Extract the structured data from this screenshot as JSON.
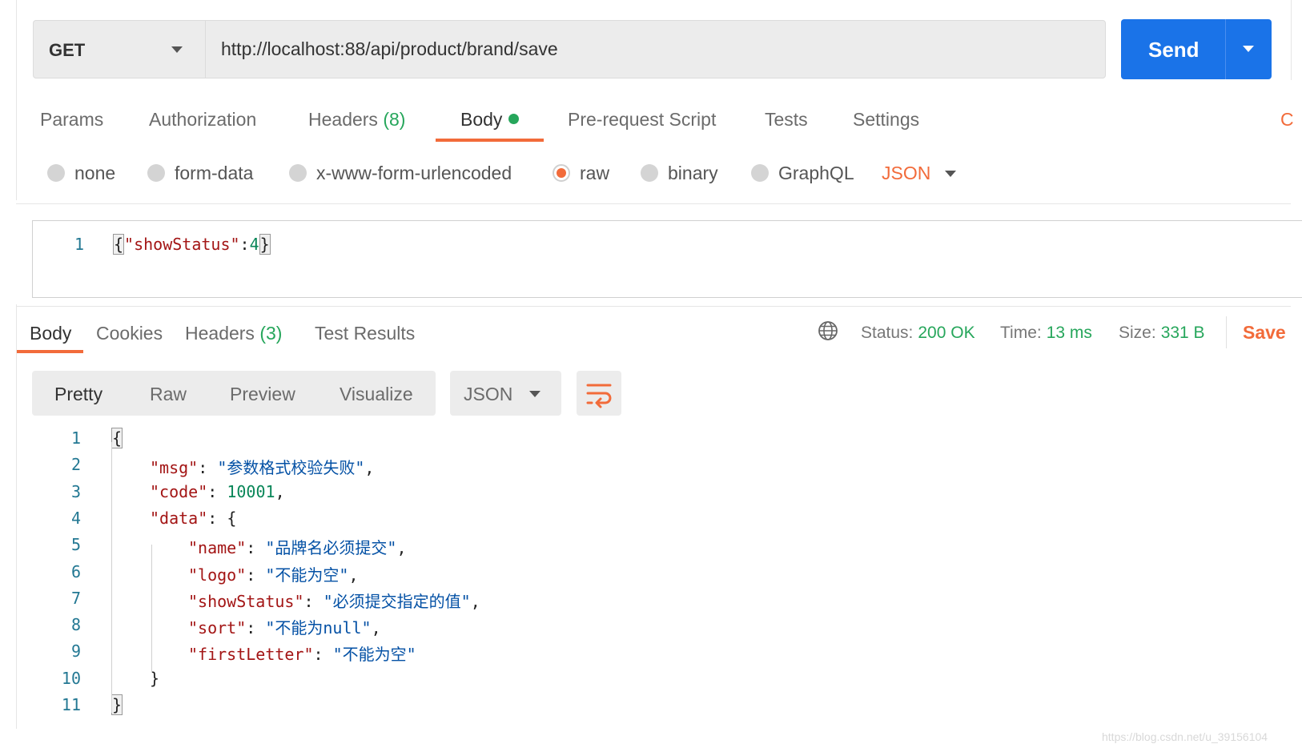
{
  "request": {
    "method": "GET",
    "url": "http://localhost:88/api/product/brand/save",
    "send_label": "Send"
  },
  "request_tabs": {
    "params": "Params",
    "authorization": "Authorization",
    "headers": "Headers",
    "headers_count": "(8)",
    "body": "Body",
    "pre_request": "Pre-request Script",
    "tests": "Tests",
    "settings": "Settings",
    "cookies_partial": "C"
  },
  "body_types": {
    "none": "none",
    "form_data": "form-data",
    "urlencoded": "x-www-form-urlencoded",
    "raw": "raw",
    "binary": "binary",
    "graphql": "GraphQL",
    "format": "JSON",
    "selected": "raw"
  },
  "request_body": {
    "line_no": "1",
    "open": "{",
    "key": "\"showStatus\"",
    "colon": ":",
    "value": "4",
    "close": "}"
  },
  "response_tabs": {
    "body": "Body",
    "cookies": "Cookies",
    "headers": "Headers",
    "headers_count": "(3)",
    "test_results": "Test Results"
  },
  "response_meta": {
    "status_label": "Status:",
    "status_value": "200 OK",
    "time_label": "Time:",
    "time_value": "13 ms",
    "size_label": "Size:",
    "size_value": "331 B",
    "save_label": "Save"
  },
  "view_modes": {
    "pretty": "Pretty",
    "raw": "Raw",
    "preview": "Preview",
    "visualize": "Visualize",
    "format": "JSON"
  },
  "response_lines": [
    {
      "no": "1",
      "indent": 0,
      "parts": [
        {
          "c": "p",
          "t": "{",
          "box": true
        }
      ]
    },
    {
      "no": "2",
      "indent": 1,
      "parts": [
        {
          "c": "k",
          "t": "\"msg\""
        },
        {
          "c": "p",
          "t": ": "
        },
        {
          "c": "s",
          "t": "\"参数格式校验失败\""
        },
        {
          "c": "p",
          "t": ","
        }
      ]
    },
    {
      "no": "3",
      "indent": 1,
      "parts": [
        {
          "c": "k",
          "t": "\"code\""
        },
        {
          "c": "p",
          "t": ": "
        },
        {
          "c": "n",
          "t": "10001"
        },
        {
          "c": "p",
          "t": ","
        }
      ]
    },
    {
      "no": "4",
      "indent": 1,
      "parts": [
        {
          "c": "k",
          "t": "\"data\""
        },
        {
          "c": "p",
          "t": ": {"
        }
      ]
    },
    {
      "no": "5",
      "indent": 2,
      "parts": [
        {
          "c": "k",
          "t": "\"name\""
        },
        {
          "c": "p",
          "t": ": "
        },
        {
          "c": "s",
          "t": "\"品牌名必须提交\""
        },
        {
          "c": "p",
          "t": ","
        }
      ]
    },
    {
      "no": "6",
      "indent": 2,
      "parts": [
        {
          "c": "k",
          "t": "\"logo\""
        },
        {
          "c": "p",
          "t": ": "
        },
        {
          "c": "s",
          "t": "\"不能为空\""
        },
        {
          "c": "p",
          "t": ","
        }
      ]
    },
    {
      "no": "7",
      "indent": 2,
      "parts": [
        {
          "c": "k",
          "t": "\"showStatus\""
        },
        {
          "c": "p",
          "t": ": "
        },
        {
          "c": "s",
          "t": "\"必须提交指定的值\""
        },
        {
          "c": "p",
          "t": ","
        }
      ]
    },
    {
      "no": "8",
      "indent": 2,
      "parts": [
        {
          "c": "k",
          "t": "\"sort\""
        },
        {
          "c": "p",
          "t": ": "
        },
        {
          "c": "s",
          "t": "\"不能为null\""
        },
        {
          "c": "p",
          "t": ","
        }
      ]
    },
    {
      "no": "9",
      "indent": 2,
      "parts": [
        {
          "c": "k",
          "t": "\"firstLetter\""
        },
        {
          "c": "p",
          "t": ": "
        },
        {
          "c": "s",
          "t": "\"不能为空\""
        }
      ]
    },
    {
      "no": "10",
      "indent": 1,
      "parts": [
        {
          "c": "p",
          "t": "}"
        }
      ]
    },
    {
      "no": "11",
      "indent": 0,
      "parts": [
        {
          "c": "p",
          "t": "}",
          "box": true
        }
      ]
    }
  ],
  "watermark": "https://blog.csdn.net/u_39156104",
  "colors": {
    "accent_orange": "#f26b3a",
    "send_blue": "#1a73e8",
    "status_green": "#26a65b"
  }
}
